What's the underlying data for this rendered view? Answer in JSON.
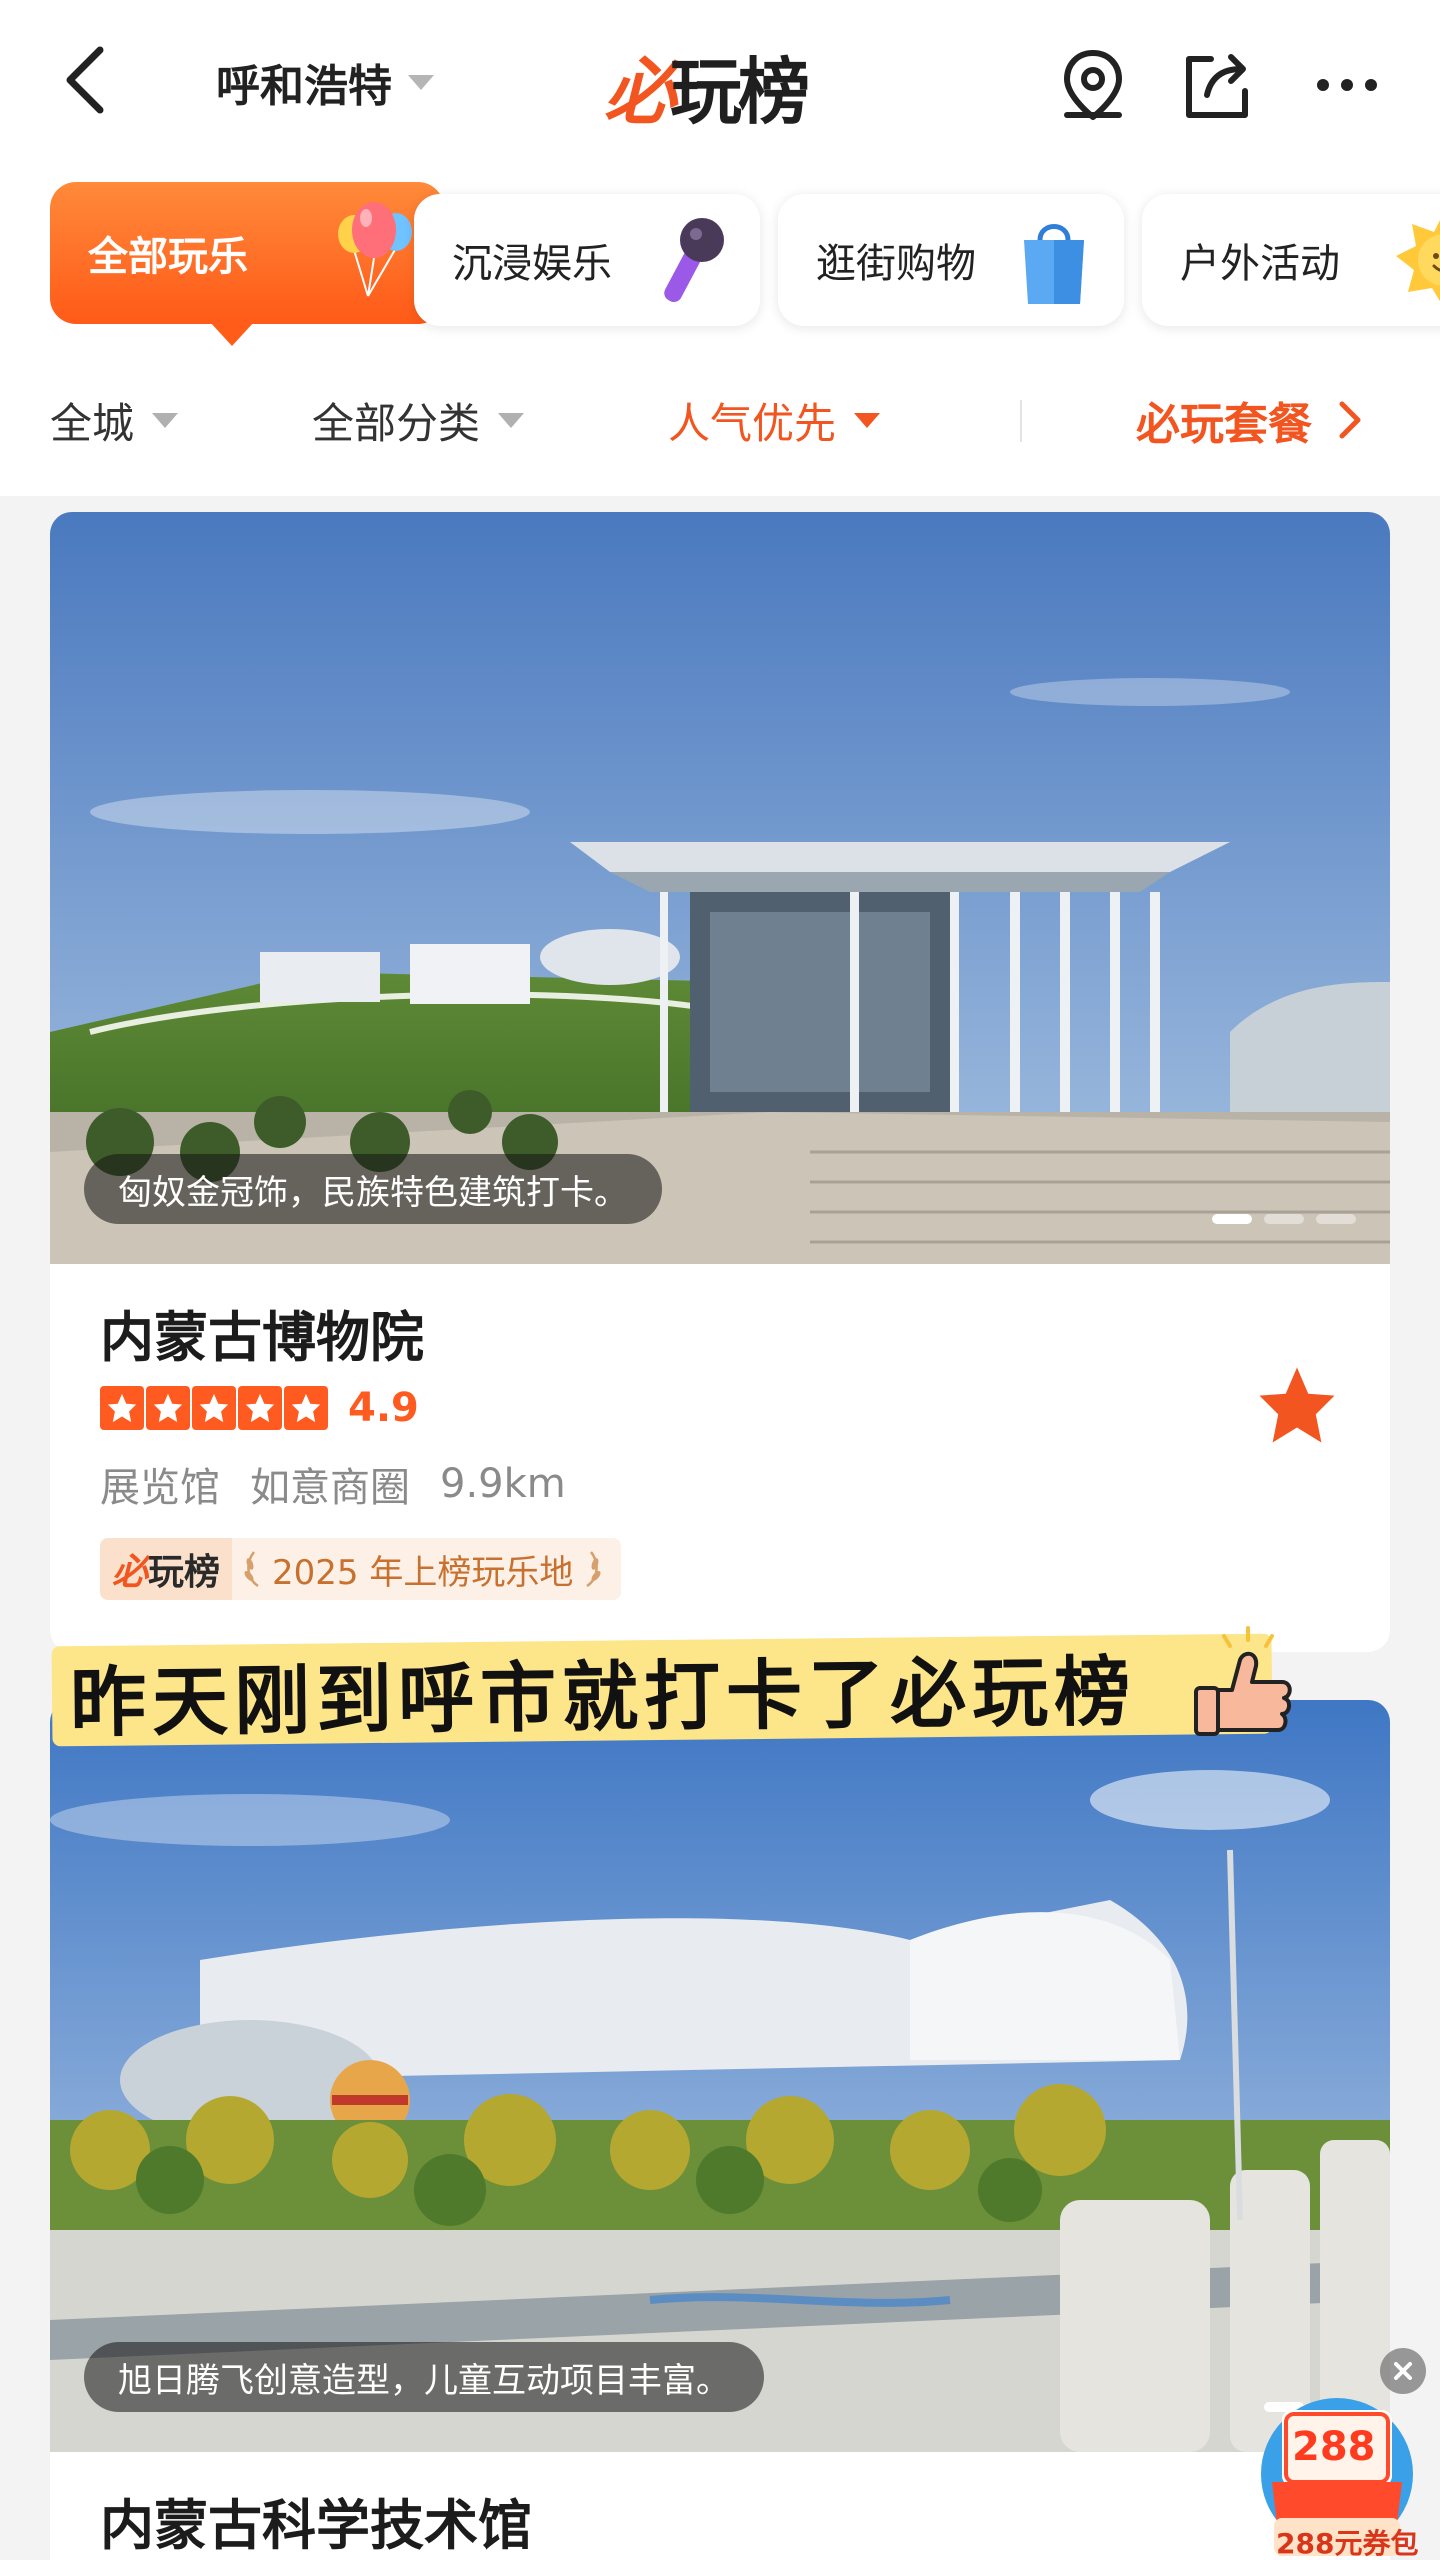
{
  "header": {
    "city": "呼和浩特",
    "logo_accent": "必",
    "logo_main": "玩榜"
  },
  "tabs": [
    {
      "label": "全部玩乐",
      "icon": "balloons-icon",
      "active": true
    },
    {
      "label": "沉浸娱乐",
      "icon": "microphone-icon"
    },
    {
      "label": "逛街购物",
      "icon": "shopping-bag-icon"
    },
    {
      "label": "户外活动",
      "icon": "sun-icon"
    }
  ],
  "filters": {
    "area": "全城",
    "category": "全部分类",
    "sort": "人气优先",
    "combo": "必玩套餐"
  },
  "cards": [
    {
      "caption": "匈奴金冠饰，民族特色建筑打卡。",
      "name": "内蒙古博物院",
      "score": "4.9",
      "type": "展览馆",
      "district": "如意商圈",
      "distance": "9.9km",
      "badge_logo_accent": "必",
      "badge_logo_main": "玩榜",
      "badge_text": "2025 年上榜玩乐地"
    },
    {
      "caption": "旭日腾飞创意造型，儿童互动项目丰富。",
      "name": "内蒙古科学技术馆"
    }
  ],
  "sticker": {
    "text": "昨天刚到呼市就打卡了必玩榜"
  },
  "coupon": {
    "amount": "288",
    "label": "288元券包"
  },
  "colors": {
    "brand": "#f2551f",
    "tab_active": "#ff6a24",
    "sticker_bg": "#fde58a"
  }
}
